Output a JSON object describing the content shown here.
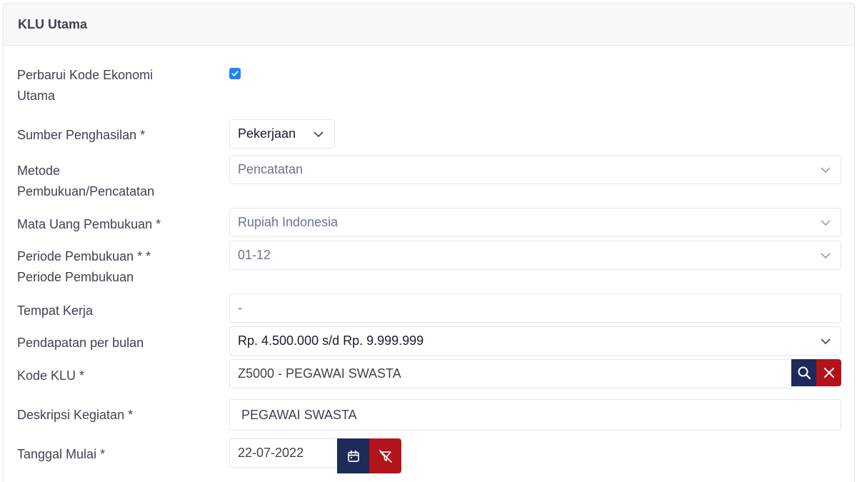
{
  "card": {
    "title": "KLU Utama"
  },
  "fields": {
    "perbarui": {
      "label_line1": "Perbarui Kode Ekonomi",
      "label_line2": "Utama",
      "checked": true
    },
    "sumber": {
      "label": "Sumber Penghasilan *",
      "value": "Pekerjaan"
    },
    "metode": {
      "label_line1": "Metode",
      "label_line2": "Pembukuan/Pencatatan",
      "value": "Pencatatan"
    },
    "mata_uang": {
      "label": "Mata Uang Pembukuan *",
      "value": "Rupiah Indonesia"
    },
    "periode": {
      "label_line1": "Periode Pembukuan * *",
      "label_line2": "Periode Pembukuan",
      "value": "01-12"
    },
    "tempat_kerja": {
      "label": "Tempat Kerja",
      "value": "-"
    },
    "pendapatan": {
      "label": "Pendapatan per bulan",
      "value": "Rp. 4.500.000 s/d Rp. 9.999.999"
    },
    "kode_klu": {
      "label": "Kode KLU  *",
      "value": "Z5000 - PEGAWAI SWASTA"
    },
    "deskripsi": {
      "label": "Deskripsi Kegiatan  *",
      "value": "PEGAWAI SWASTA"
    },
    "tanggal": {
      "label": "Tanggal Mulai  *",
      "value": "22-07-2022"
    }
  },
  "icons": {
    "checkbox": "check-icon",
    "dropdown": "chevron-down-icon",
    "search": "search-icon",
    "clear": "close-icon",
    "calendar": "calendar-icon",
    "filter_clear": "filter-clear-icon"
  },
  "colors": {
    "navy": "#1e2a5a",
    "red": "#b3141c",
    "checkbox": "#1b84ff"
  }
}
